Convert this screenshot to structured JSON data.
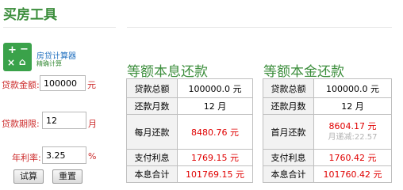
{
  "page": {
    "title": "买房工具"
  },
  "logo": {
    "title": "房贷计算器",
    "subtitle": "精确计算",
    "glyphs": [
      "+",
      "−",
      "×",
      "⌂"
    ]
  },
  "form": {
    "amount": {
      "label": "贷款金额:",
      "value": "100000",
      "unit": "元"
    },
    "term": {
      "label": "贷款期限:",
      "value": "12",
      "unit": "月"
    },
    "rate": {
      "label": "年利率:",
      "value": "3.25",
      "unit": "%"
    },
    "calc_button": "试算",
    "reset_button": "重置"
  },
  "equal_payment": {
    "title": "等额本息还款",
    "rows": [
      {
        "key": "贷款总额",
        "value": "100000.0 元"
      },
      {
        "key": "还款月数",
        "value": "12 月"
      },
      {
        "key": "每月还款",
        "value": "8480.76 元"
      },
      {
        "key": "支付利息",
        "value": "1769.15 元"
      },
      {
        "key": "本息合计",
        "value": "101769.15 元"
      }
    ]
  },
  "equal_principal": {
    "title": "等额本金还款",
    "rows": [
      {
        "key": "贷款总额",
        "value": "100000.0 元"
      },
      {
        "key": "还款月数",
        "value": "12 月"
      },
      {
        "key": "首月还款",
        "value": "8604.17 元",
        "note": "月递减:22.57"
      },
      {
        "key": "支付利息",
        "value": "1760.42 元"
      },
      {
        "key": "本息合计",
        "value": "101760.42 元"
      }
    ]
  },
  "colors": {
    "green": "#3b8d3b",
    "red": "#e00000",
    "label_red": "#cc2a2a",
    "logo_bg": "#3aa24a",
    "link_blue": "#1f6fbf"
  }
}
